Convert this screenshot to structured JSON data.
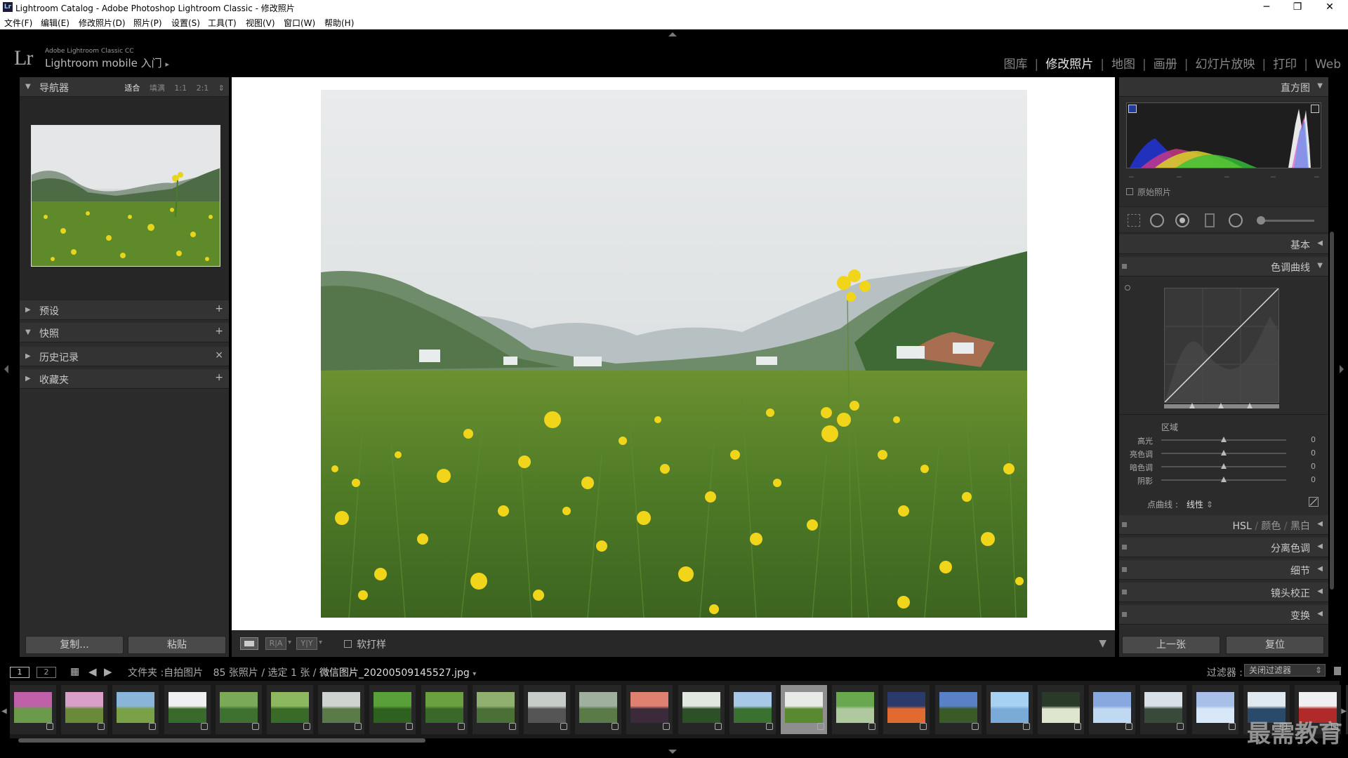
{
  "window": {
    "title": "Lightroom Catalog - Adobe Photoshop Lightroom Classic - 修改照片",
    "app_icon": "Lr"
  },
  "menu": [
    "文件(F)",
    "编辑(E)",
    "修改照片(D)",
    "照片(P)",
    "设置(S)",
    "工具(T)",
    "视图(V)",
    "窗口(W)",
    "帮助(H)"
  ],
  "brand": {
    "logo": "Lr",
    "line1": "Adobe Lightroom Classic CC",
    "line2": "Lightroom mobile 入门",
    "arrow": "▸"
  },
  "modules": [
    {
      "label": "图库",
      "active": false
    },
    {
      "label": "修改照片",
      "active": true
    },
    {
      "label": "地图",
      "active": false
    },
    {
      "label": "画册",
      "active": false
    },
    {
      "label": "幻灯片放映",
      "active": false
    },
    {
      "label": "打印",
      "active": false
    },
    {
      "label": "Web",
      "active": false
    }
  ],
  "left": {
    "navigator": {
      "title": "导航器",
      "options": [
        "适合",
        "填满",
        "1:1",
        "2:1"
      ],
      "selected": "适合"
    },
    "panels": [
      {
        "label": "预设",
        "action": "+",
        "expanded": false
      },
      {
        "label": "快照",
        "action": "+",
        "expanded": true
      },
      {
        "label": "历史记录",
        "action": "×",
        "expanded": false
      },
      {
        "label": "收藏夹",
        "action": "+",
        "expanded": false
      }
    ],
    "copy_button": "复制...",
    "paste_button": "粘贴"
  },
  "toolbar": {
    "softproof_label": "软打样",
    "view_ra": "R|A",
    "view_yy": "Y|Y"
  },
  "right": {
    "histogram": {
      "title": "直方图",
      "original_label": "原始照片"
    },
    "basic": "基本",
    "tone_curve": {
      "title": "色调曲线",
      "region_label": "区域",
      "sliders": [
        {
          "label": "高光",
          "value": "0"
        },
        {
          "label": "亮色调",
          "value": "0"
        },
        {
          "label": "暗色调",
          "value": "0"
        },
        {
          "label": "阴影",
          "value": "0"
        }
      ],
      "point_curve_label": "点曲线 :",
      "point_curve_value": "线性"
    },
    "hsl": [
      "HSL",
      "颜色",
      "黑白"
    ],
    "panels": [
      "分离色调",
      "细节",
      "镜头校正",
      "变换"
    ],
    "prev_button": "上一张",
    "reset_button": "复位"
  },
  "filmbar": {
    "page1": "1",
    "page2": "2",
    "source_prefix": "文件夹 :",
    "source": "自拍图片",
    "count": "85 张照片 / 选定 1 张 /",
    "filename": "微信图片_20200509145527.jpg",
    "filter_label": "过滤器 :",
    "filter_value": "关闭过滤器"
  },
  "watermark": "最需教育",
  "colors": {
    "accent_active": "#e8e8e8",
    "panel_bg": "#2b2b2b",
    "panel_head": "#333333",
    "center_bg": "#ffffff"
  }
}
